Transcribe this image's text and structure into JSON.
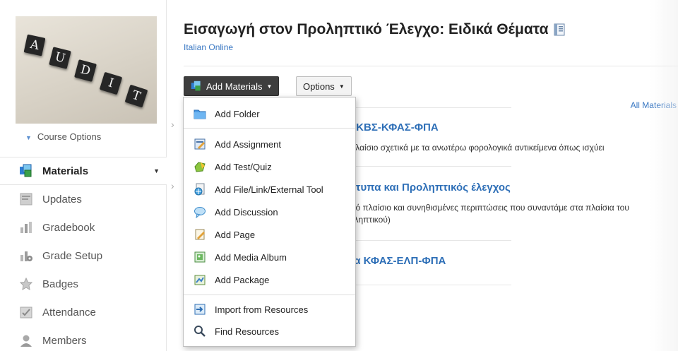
{
  "course": {
    "image_tiles": [
      "A",
      "U",
      "D",
      "I",
      "T"
    ],
    "options_label": "Course Options"
  },
  "nav": {
    "items": [
      {
        "label": "Materials",
        "icon": "materials-icon",
        "active": true
      },
      {
        "label": "Updates",
        "icon": "updates-icon"
      },
      {
        "label": "Gradebook",
        "icon": "gradebook-icon"
      },
      {
        "label": "Grade Setup",
        "icon": "grade-setup-icon"
      },
      {
        "label": "Badges",
        "icon": "badge-icon"
      },
      {
        "label": "Attendance",
        "icon": "attendance-icon"
      },
      {
        "label": "Members",
        "icon": "members-icon"
      }
    ]
  },
  "header": {
    "title": "Εισαγωγή στον Προληπτικό Έλεγχο: Ειδικά Θέματα",
    "subtitle": "Italian Online"
  },
  "toolbar": {
    "add_materials_label": "Add Materials",
    "options_label": "Options",
    "all_materials_label": "All Materials"
  },
  "materials": [
    {
      "title": ": ΚΒΣ-ΚΦΑΣ-ΦΠΑ",
      "desc": "πλαίσιο σχετικά με τα ανωτέρω φορολογικά αντικείμενα όπως ισχύει"
    },
    {
      "title": "ότυπα και Προληπτικός έλεγχος",
      "desc": "ικό πλαίσιο και συνηθισμένες περιπτώσεις που συναντάμε στα πλαίσια του",
      "desc2": "οληπτικού)"
    },
    {
      "title": "τα ΚΦΑΣ-ΕΛΠ-ΦΠΑ",
      "desc": ""
    }
  ],
  "menu": {
    "items": [
      {
        "label": "Add Folder",
        "icon": "folder-icon"
      },
      {
        "label": "Add Assignment",
        "icon": "assignment-icon"
      },
      {
        "label": "Add Test/Quiz",
        "icon": "quiz-icon"
      },
      {
        "label": "Add File/Link/External Tool",
        "icon": "file-link-icon"
      },
      {
        "label": "Add Discussion",
        "icon": "discussion-icon"
      },
      {
        "label": "Add Page",
        "icon": "page-icon"
      },
      {
        "label": "Add Media Album",
        "icon": "media-album-icon"
      },
      {
        "label": "Add Package",
        "icon": "package-icon"
      },
      {
        "label": "Import from Resources",
        "icon": "import-icon"
      },
      {
        "label": "Find Resources",
        "icon": "search-icon"
      }
    ]
  },
  "colors": {
    "link": "#3a78c3",
    "material_title": "#2e6fb7",
    "button_dark": "#3e3e3e"
  }
}
